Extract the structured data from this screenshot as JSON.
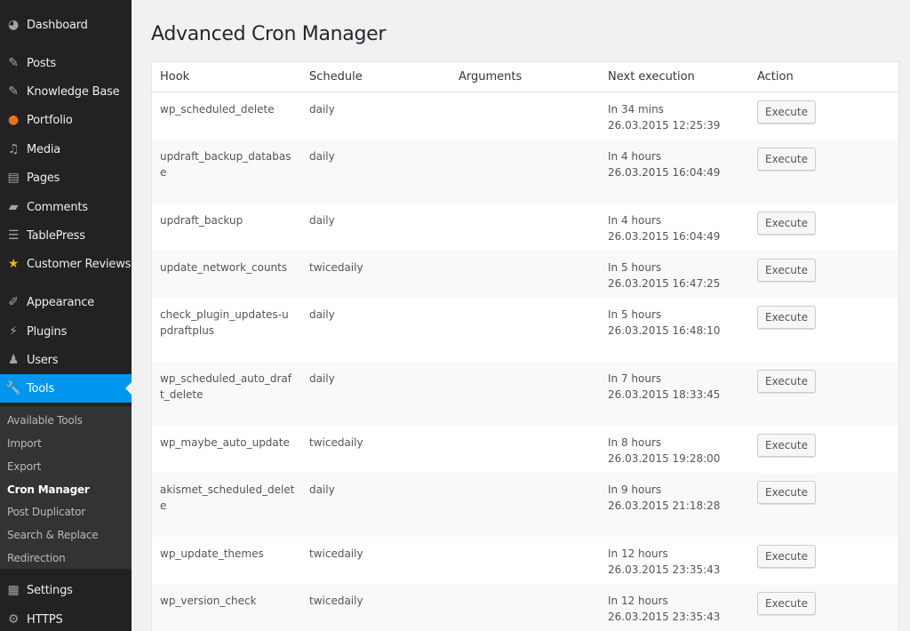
{
  "sidebar": {
    "items": [
      {
        "label": "Dashboard",
        "icon": "dashboard-icon",
        "glyph": "◕"
      },
      {
        "label": "Posts",
        "icon": "pin-icon",
        "glyph": "✎"
      },
      {
        "label": "Knowledge Base",
        "icon": "pin-icon",
        "glyph": "✎"
      },
      {
        "label": "Portfolio",
        "icon": "portfolio-icon",
        "glyph": "●"
      },
      {
        "label": "Media",
        "icon": "media-icon",
        "glyph": "♫"
      },
      {
        "label": "Pages",
        "icon": "pages-icon",
        "glyph": "▤"
      },
      {
        "label": "Comments",
        "icon": "comments-icon",
        "glyph": "▰"
      },
      {
        "label": "TablePress",
        "icon": "table-icon",
        "glyph": "☰"
      },
      {
        "label": "Customer Reviews",
        "icon": "star-icon",
        "glyph": "★"
      },
      {
        "label": "Appearance",
        "icon": "brush-icon",
        "glyph": "✐"
      },
      {
        "label": "Plugins",
        "icon": "plug-icon",
        "glyph": "⚡"
      },
      {
        "label": "Users",
        "icon": "user-icon",
        "glyph": "♟"
      },
      {
        "label": "Tools",
        "icon": "wrench-icon",
        "glyph": "🔧"
      },
      {
        "label": "Settings",
        "icon": "settings-icon",
        "glyph": "▦"
      },
      {
        "label": "HTTPS",
        "icon": "gear-icon",
        "glyph": "⚙"
      }
    ],
    "submenu": [
      {
        "label": "Available Tools"
      },
      {
        "label": "Import"
      },
      {
        "label": "Export"
      },
      {
        "label": "Cron Manager"
      },
      {
        "label": "Post Duplicator"
      },
      {
        "label": "Search & Replace"
      },
      {
        "label": "Redirection"
      }
    ],
    "active_color": "#0096ee"
  },
  "main": {
    "title": "Advanced Cron Manager",
    "table": {
      "headers": [
        "Hook",
        "Schedule",
        "Arguments",
        "Next execution",
        "Action"
      ],
      "rows": [
        {
          "hook": "wp_scheduled_delete",
          "schedule": "daily",
          "arguments": "",
          "relative": "In 34 mins",
          "datetime": "26.03.2015 12:25:39",
          "action": "Execute"
        },
        {
          "hook": "updraft_backup_database",
          "schedule": "daily",
          "arguments": "",
          "relative": "In 4 hours",
          "datetime": "26.03.2015 16:04:49",
          "action": "Execute"
        },
        {
          "hook": "updraft_backup",
          "schedule": "daily",
          "arguments": "",
          "relative": "In 4 hours",
          "datetime": "26.03.2015 16:04:49",
          "action": "Execute"
        },
        {
          "hook": "update_network_counts",
          "schedule": "twicedaily",
          "arguments": "",
          "relative": "In 5 hours",
          "datetime": "26.03.2015 16:47:25",
          "action": "Execute"
        },
        {
          "hook": "check_plugin_updates-updraftplus",
          "schedule": "daily",
          "arguments": "",
          "relative": "In 5 hours",
          "datetime": "26.03.2015 16:48:10",
          "action": "Execute"
        },
        {
          "hook": "wp_scheduled_auto_draft_delete",
          "schedule": "daily",
          "arguments": "",
          "relative": "In 7 hours",
          "datetime": "26.03.2015 18:33:45",
          "action": "Execute"
        },
        {
          "hook": "wp_maybe_auto_update",
          "schedule": "twicedaily",
          "arguments": "",
          "relative": "In 8 hours",
          "datetime": "26.03.2015 19:28:00",
          "action": "Execute"
        },
        {
          "hook": "akismet_scheduled_delete",
          "schedule": "daily",
          "arguments": "",
          "relative": "In 9 hours",
          "datetime": "26.03.2015 21:18:28",
          "action": "Execute"
        },
        {
          "hook": "wp_update_themes",
          "schedule": "twicedaily",
          "arguments": "",
          "relative": "In 12 hours",
          "datetime": "26.03.2015 23:35:43",
          "action": "Execute"
        },
        {
          "hook": "wp_version_check",
          "schedule": "twicedaily",
          "arguments": "",
          "relative": "In 12 hours",
          "datetime": "26.03.2015 23:35:43",
          "action": "Execute"
        }
      ]
    }
  }
}
